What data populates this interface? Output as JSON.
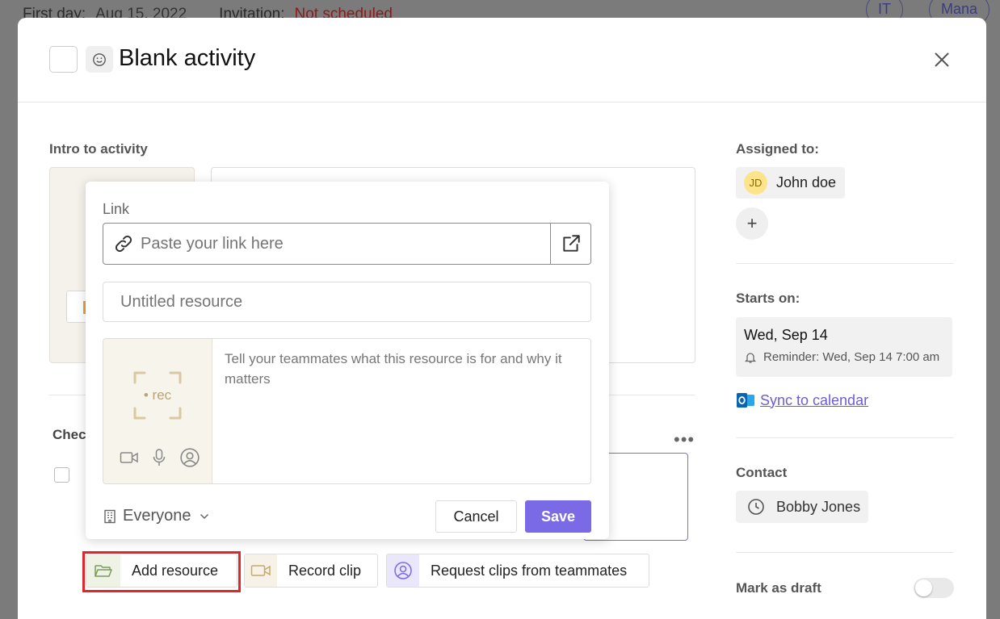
{
  "background": {
    "first_day_label": "First day:",
    "first_day_value": "Aug 15, 2022",
    "invitation_label": "Invitation:",
    "invitation_value": "Not scheduled",
    "pill_it": "IT",
    "pill_mana": "Mana"
  },
  "modal": {
    "title": "Blank activity",
    "intro_label": "Intro to activity",
    "checklist_label": "Chec"
  },
  "resource_buttons": {
    "add_resource": "Add resource",
    "record_clip": "Record clip",
    "request_clips": "Request clips from teammates"
  },
  "popover": {
    "link_label": "Link",
    "link_placeholder": "Paste your link here",
    "title_placeholder": "Untitled resource",
    "rec_label": "rec",
    "description_placeholder": "Tell your teammates what this resource is for and why it matters",
    "audience": "Everyone",
    "cancel": "Cancel",
    "save": "Save"
  },
  "sidebar": {
    "assigned_label": "Assigned to:",
    "assignee_initials": "JD",
    "assignee_name": "John doe",
    "starts_label": "Starts on:",
    "start_date": "Wed, Sep 14",
    "reminder": "Reminder: Wed, Sep 14 7:00 am",
    "sync": "Sync to calendar",
    "contact_label": "Contact",
    "contact_name": "Bobby Jones",
    "draft_label": "Mark as draft",
    "draft_on": false
  },
  "colors": {
    "accent": "#7a6ae6",
    "highlight": "#e0262b",
    "avatar_bg": "#fde38a"
  }
}
